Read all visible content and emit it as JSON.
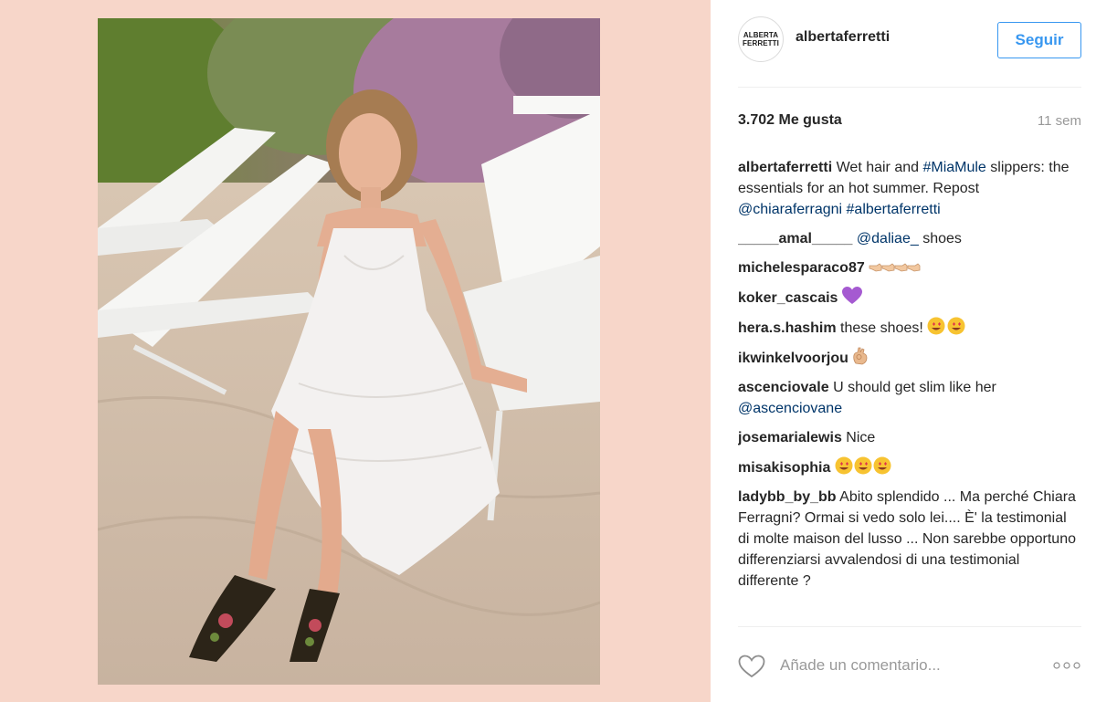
{
  "post": {
    "username": "albertaferretti",
    "follow_label": "Seguir",
    "avatar_logo_lines": [
      "ALBERTA",
      "FERRETTI"
    ],
    "likes": "3.702 Me gusta",
    "time": "11 sem",
    "add_comment_placeholder": "Añade un comentario..."
  },
  "caption": {
    "user": "albertaferretti",
    "text_1": " Wet hair and ",
    "hashtag_1": "#MiaMule",
    "text_2": " slippers: the essentials for an hot summer. Repost ",
    "mention": "@chiaraferragni",
    "text_3": " ",
    "hashtag_2": "#albertaferretti"
  },
  "comments": [
    {
      "user": "_____amal_____",
      "mention": "@daliae_",
      "text": " shoes"
    },
    {
      "user": "michelesparaco87",
      "text": " "
    },
    {
      "user": "koker_cascais",
      "text": " "
    },
    {
      "user": "hera.s.hashim",
      "text": " these shoes! "
    },
    {
      "user": "ikwinkelvoorjou",
      "text": " "
    },
    {
      "user": "ascenciovale",
      "text": " U should get slim like her ",
      "mention": "@ascenciovane"
    },
    {
      "user": "josemarialewis",
      "text": " Nice"
    },
    {
      "user": "misakisophia",
      "text": " "
    },
    {
      "user": "ladybb_by_bb",
      "text": " Abito splendido ... Ma perché Chiara Ferragni? Ormai si vedo solo lei.... È' la testimonial di molte maison del lusso ... Non sarebbe opportuno differenziarsi avvalendosi di una testimonial differente ?"
    }
  ],
  "icons": {
    "like": "heart-outline-icon",
    "more": "ellipsis-icon",
    "emoji_hands": "pointing-hands-emoji",
    "emoji_heart": "purple-heart-emoji",
    "emoji_heart_eyes": "heart-eyes-emoji",
    "emoji_ok": "ok-hand-emoji"
  },
  "colors": {
    "backdrop": "#f7d6c9",
    "accent": "#3897f0",
    "link": "#003569",
    "muted": "#999999",
    "text": "#262626"
  }
}
